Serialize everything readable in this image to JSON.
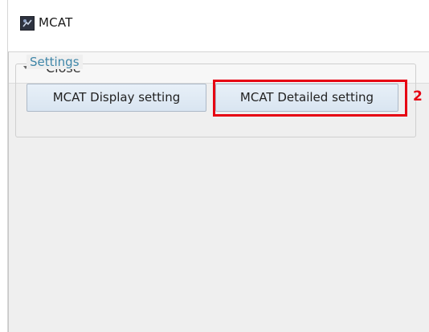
{
  "window": {
    "title": "MCAT",
    "icon": "mcat-app-icon"
  },
  "expander": {
    "label": "Close",
    "state": "expanded",
    "icon": "chevron-down-icon"
  },
  "settings_group": {
    "legend": "Settings",
    "buttons": [
      {
        "label": "MCAT Display setting"
      },
      {
        "label": "MCAT Detailed setting"
      }
    ]
  },
  "annotation": {
    "callout": "2",
    "color": "#e60012"
  },
  "colors": {
    "legend_text": "#3f86a8",
    "button_fill": "#d9e5f1",
    "panel_background": "#efefef"
  }
}
